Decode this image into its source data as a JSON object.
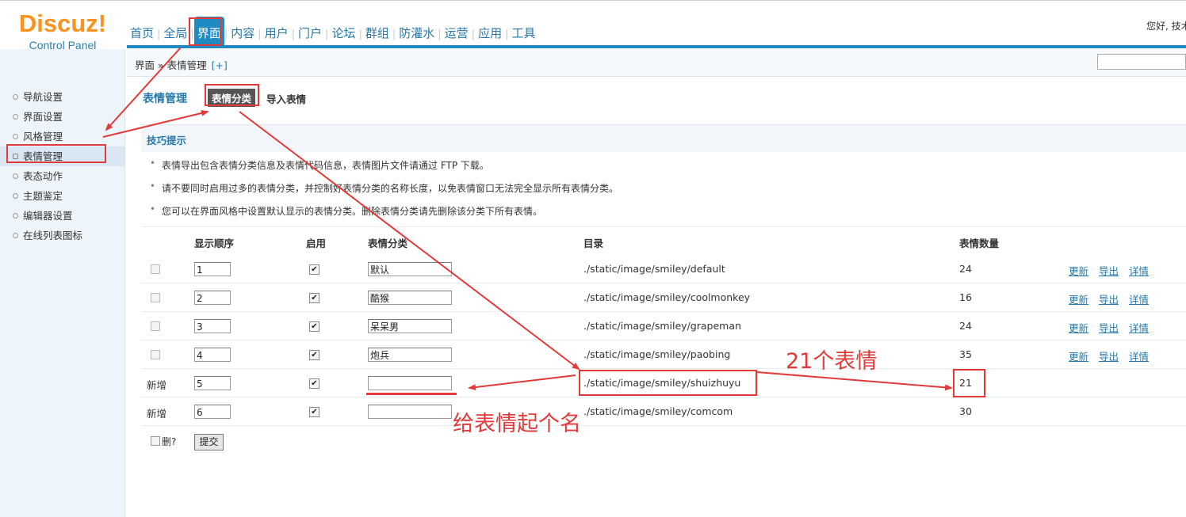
{
  "logo": {
    "main": "Discuz!",
    "sub": "Control Panel"
  },
  "header": {
    "nav": [
      "首页",
      "全局",
      "界面",
      "内容",
      "用户",
      "门户",
      "论坛",
      "群组",
      "防灌水",
      "运营",
      "应用",
      "工具"
    ],
    "active_index": 2,
    "greeting": "您好, 技术"
  },
  "breadcrumb": {
    "path": "界面 » 表情管理",
    "plus": "[+]"
  },
  "sidebar": {
    "items": [
      "导航设置",
      "界面设置",
      "风格管理",
      "表情管理",
      "表态动作",
      "主题鉴定",
      "编辑器设置",
      "在线列表图标"
    ],
    "active_index": 3
  },
  "main": {
    "title": "表情管理",
    "tabs": [
      "表情分类",
      "导入表情"
    ],
    "tips_title": "技巧提示",
    "tips": [
      "表情导出包含表情分类信息及表情代码信息，表情图片文件请通过 FTP 下载。",
      "请不要同时启用过多的表情分类，并控制好表情分类的名称长度，以免表情窗口无法完全显示所有表情分类。",
      "您可以在界面风格中设置默认显示的表情分类。删除表情分类请先删除该分类下所有表情。"
    ]
  },
  "table": {
    "headers": {
      "order": "显示顺序",
      "enabled": "启用",
      "category": "表情分类",
      "directory": "目录",
      "count": "表情数量"
    },
    "rows": [
      {
        "lead": "",
        "order": "1",
        "enabled": true,
        "name": "默认",
        "dir": "./static/image/smiley/default",
        "count": "24",
        "actions": [
          "更新",
          "导出",
          "详情"
        ]
      },
      {
        "lead": "",
        "order": "2",
        "enabled": true,
        "name": "酷猴",
        "dir": "./static/image/smiley/coolmonkey",
        "count": "16",
        "actions": [
          "更新",
          "导出",
          "详情"
        ]
      },
      {
        "lead": "",
        "order": "3",
        "enabled": true,
        "name": "呆呆男",
        "dir": "./static/image/smiley/grapeman",
        "count": "24",
        "actions": [
          "更新",
          "导出",
          "详情"
        ]
      },
      {
        "lead": "",
        "order": "4",
        "enabled": true,
        "name": "炮兵",
        "dir": "./static/image/smiley/paobing",
        "count": "35",
        "actions": [
          "更新",
          "导出",
          "详情"
        ]
      },
      {
        "lead": "新增",
        "order": "5",
        "enabled": true,
        "name": "",
        "dir": "./static/image/smiley/shuizhuyu",
        "count": "21",
        "actions": []
      },
      {
        "lead": "新增",
        "order": "6",
        "enabled": true,
        "name": "",
        "dir": "./static/image/smiley/comcom",
        "count": "30",
        "actions": []
      }
    ],
    "delete_label": "删?",
    "submit_label": "提交"
  },
  "annotations": {
    "count_note": "21个表情",
    "name_note": "给表情起个名",
    "color": "#e23a3a"
  }
}
